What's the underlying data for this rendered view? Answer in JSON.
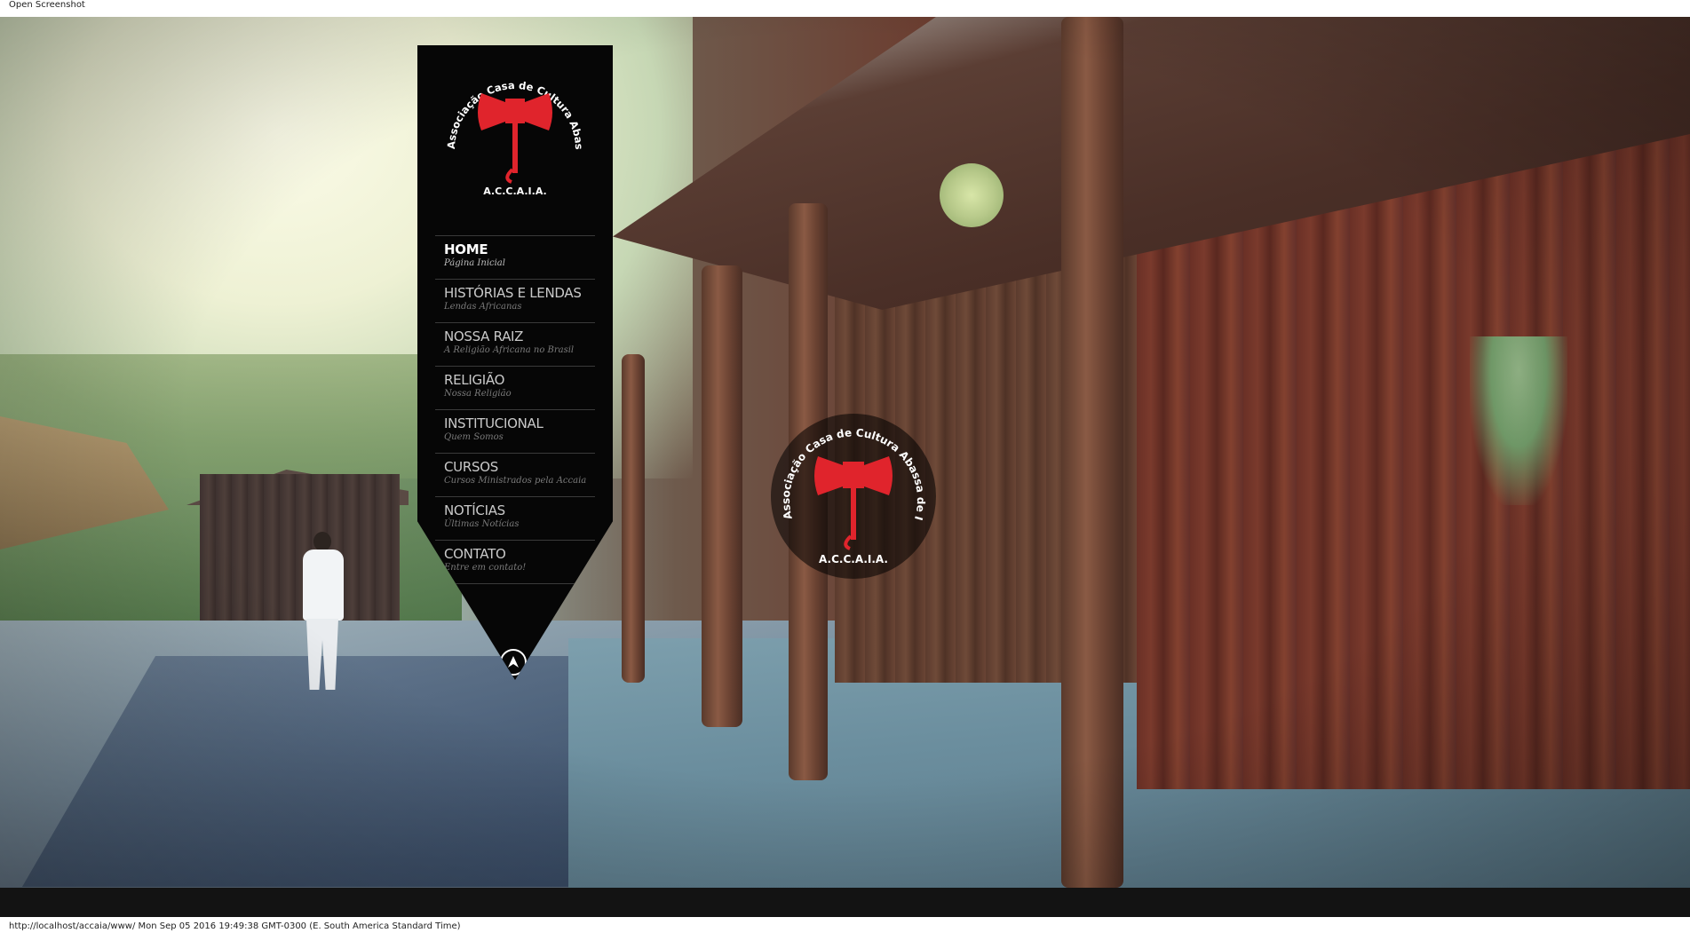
{
  "topbar": {
    "label": "Open Screenshot"
  },
  "logo": {
    "ring_text": "Associação Casa de Cultura Abassa de Inkise Nzazi",
    "acronym": "A.C.C.A.I.A.",
    "emblem_icon": "double-axe-icon",
    "emblem_color": "#e0242c"
  },
  "menu": {
    "items": [
      {
        "label": "HOME",
        "sub": "Página Inicial",
        "active": true
      },
      {
        "label": "HISTÓRIAS E LENDAS",
        "sub": "Lendas Africanas"
      },
      {
        "label": "NOSSA RAIZ",
        "sub": "A Religião Africana no Brasil"
      },
      {
        "label": "RELIGIÃO",
        "sub": "Nossa Religião"
      },
      {
        "label": "INSTITUCIONAL",
        "sub": "Quem Somos"
      },
      {
        "label": "CURSOS",
        "sub": "Cursos Ministrados pela Accaia"
      },
      {
        "label": "NOTÍCIAS",
        "sub": "Últimas Notícias"
      },
      {
        "label": "CONTATO",
        "sub": "Entre em contato!"
      }
    ],
    "scroll_top_icon": "arrow-up-circle-icon"
  },
  "statusbar": {
    "text": "http://localhost/accaia/www/ Mon Sep 05 2016 19:49:38 GMT-0300 (E. South America Standard Time)"
  }
}
